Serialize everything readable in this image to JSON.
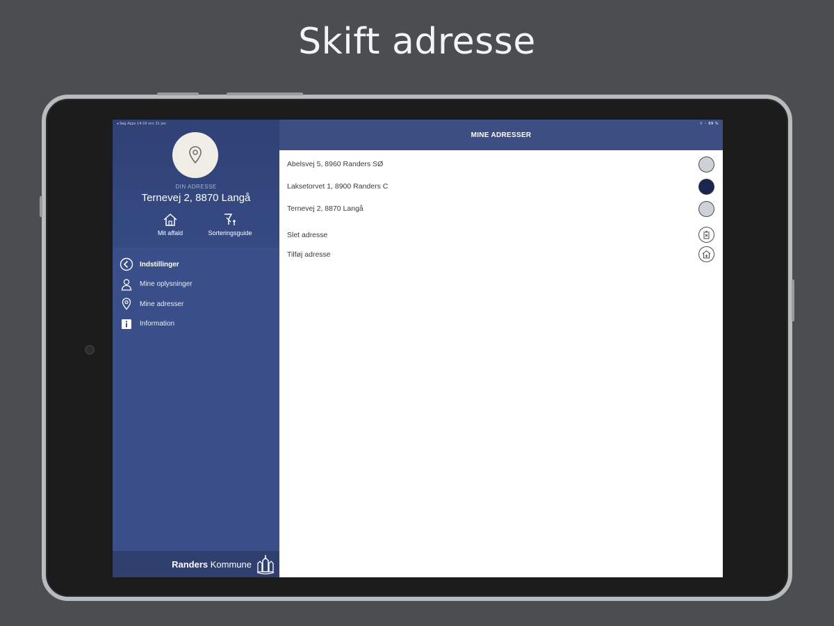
{
  "headline": "Skift adresse",
  "status_bar": {
    "left": "◂ Søg Apps  14:16  ons 31 jan",
    "right": "⌔ ◦ 89 %"
  },
  "sidebar": {
    "address_caption": "DIN ADRESSE",
    "address": "Ternevej 2, 8870 Langå",
    "quick_links": [
      {
        "label": "Mit affald",
        "icon": "house-icon"
      },
      {
        "label": "Sorteringsguide",
        "icon": "sorting-icon"
      }
    ],
    "menu": [
      {
        "label": "Indstillinger",
        "icon": "back-arrow-icon",
        "active": true
      },
      {
        "label": "Mine oplysninger",
        "icon": "person-icon",
        "active": false
      },
      {
        "label": "Mine adresser",
        "icon": "location-pin-icon",
        "active": false
      },
      {
        "label": "Information",
        "icon": "info-icon",
        "active": false
      }
    ],
    "footer": {
      "brand_bold": "Randers",
      "brand_rest": " Kommune"
    }
  },
  "main": {
    "header_title": "MINE ADRESSER",
    "addresses": [
      {
        "label": "Abelsvej 5, 8960 Randers SØ",
        "selected": false
      },
      {
        "label": "Laksetorvet 1, 8900 Randers C",
        "selected": true
      },
      {
        "label": "Ternevej 2, 8870 Langå",
        "selected": false
      }
    ],
    "actions": [
      {
        "label": "Slet adresse",
        "icon": "delete-address-icon"
      },
      {
        "label": "Tilføj adresse",
        "icon": "add-address-icon"
      }
    ]
  },
  "colors": {
    "sidebar": "#3a4f8a",
    "header": "#3d4e82",
    "selected_radio": "#1b2650",
    "unselected_radio": "#ced1d6"
  }
}
